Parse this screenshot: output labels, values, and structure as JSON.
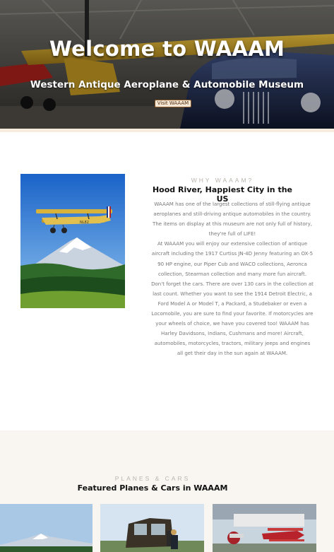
{
  "hero": {
    "title": "Welcome to WAAAM",
    "subtitle": "Western Antique Aeroplane & Automobile Museum",
    "button_label": "Visit WAAAM"
  },
  "about": {
    "eyebrow": "WHY WAAAM?",
    "heading": "Hood River, Happiest City in the US",
    "paragraphs": [
      "WAAAM has one of the largest collections of still-flying antique aeroplanes and still-driving antique automobiles in the country. The items on display at this museum are not only full of history, they're full of LIFE!",
      "At WAAAM you will enjoy our extensive collection of antique aircraft including the 1917 Curtiss JN-4D Jenny featuring an OX-5 90 HP engine, our Piper Cub and WACO collections, Aeronca collection, Stearman collection and many more fun aircraft.",
      "Don't forget the cars. There are over 130 cars in the collection at last count. Whether you want to see the 1914 Detroit Electric, a Ford Model A or Model T, a Packard, a Studebaker or even a Locomobile, you are sure to find your favorite. If motorcycles are your wheels of choice, we have you covered too! WAAAM has Harley Davidsons, Indians, Cushmans and more! Aircraft, automobiles, motorcycles, tractors, military jeeps and engines all get their day in the sun again at WAAAM."
    ],
    "image_plane_tail": "NL82"
  },
  "featured": {
    "eyebrow": "PLANES & CARS",
    "heading": "Featured Planes & Cars in WAAAM"
  },
  "colors": {
    "hero_strip": "#f7ecdd",
    "featured_bg": "#f9f6f1",
    "eyebrow": "#b9b4ad",
    "body_text": "#777777"
  }
}
